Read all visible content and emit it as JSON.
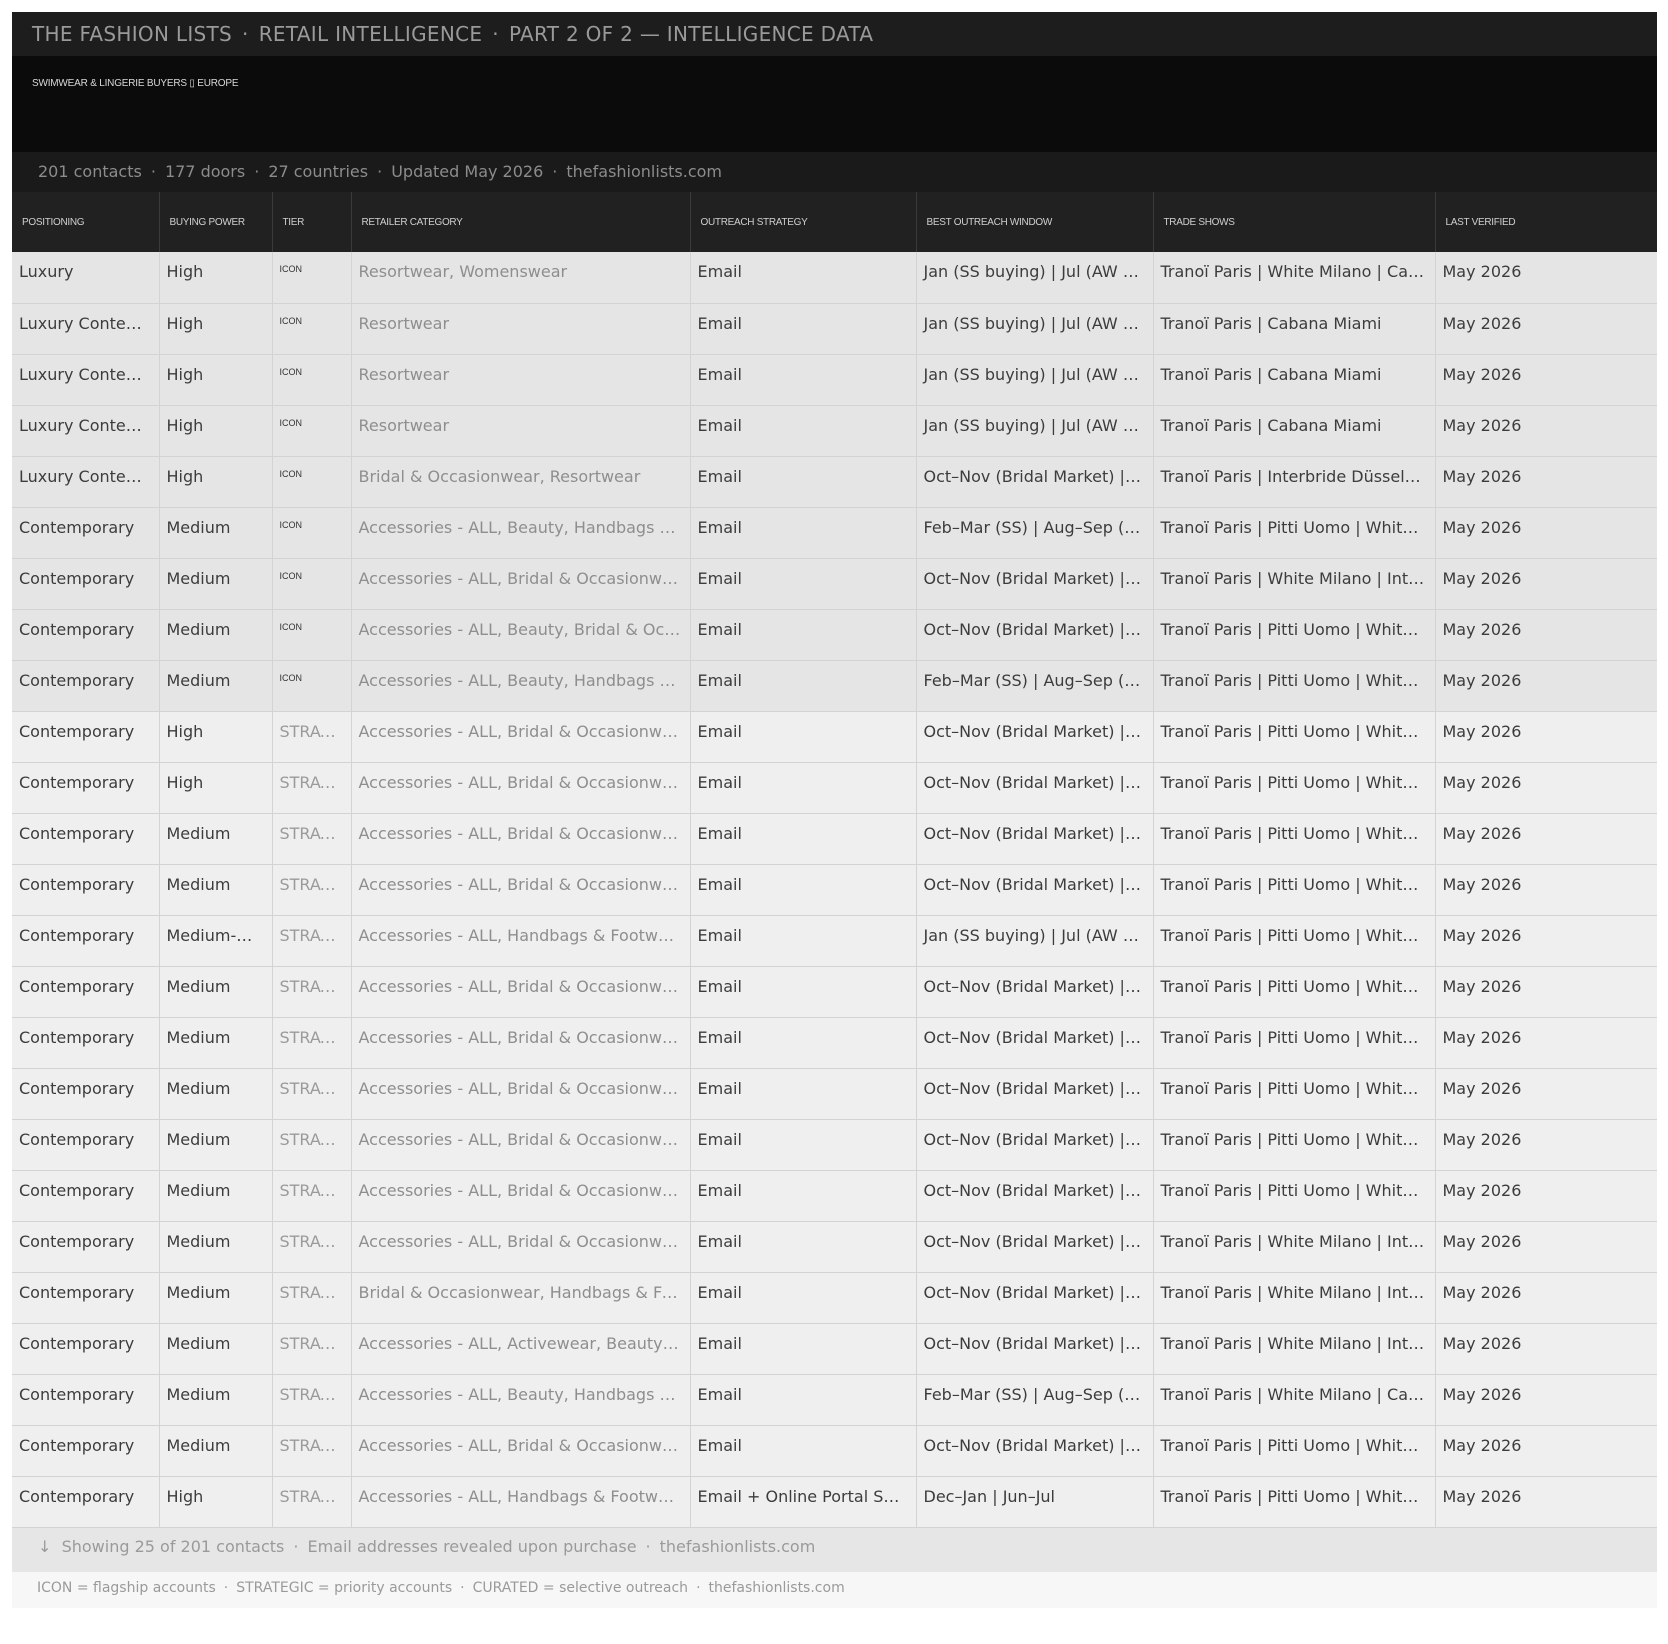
{
  "header": {
    "brand": "THE FASHION LISTS",
    "section": "RETAIL INTELLIGENCE",
    "part": "PART 2 OF 2 — INTELLIGENCE DATA",
    "separator": "·"
  },
  "hero": {
    "subtitle": "SWIMWEAR & LINGERIE BUYERS ▯ EUROPE"
  },
  "stats": {
    "contacts": "201 contacts",
    "doors": "177 doors",
    "countries": "27 countries",
    "updated": "Updated May 2026",
    "site": "thefashionlists.com"
  },
  "table": {
    "columns": [
      "POSITIONING",
      "BUYING POWER",
      "TIER",
      "RETAILER CATEGORY",
      "OUTREACH STRATEGY",
      "BEST OUTREACH WINDOW",
      "TRADE SHOWS",
      "LAST VERIFIED"
    ],
    "rows": [
      {
        "positioning": "Luxury",
        "buying_power": "High",
        "tier": "ICON",
        "category": "Resortwear, Womenswear",
        "outreach": "Email",
        "window": "Jan (SS buying) | Jul (AW buying)",
        "trade_shows": "Tranoï Paris | White Milano | Cabana Miami",
        "verified": "May 2026"
      },
      {
        "positioning": "Luxury Contemporary",
        "buying_power": "High",
        "tier": "ICON",
        "category": "Resortwear",
        "outreach": "Email",
        "window": "Jan (SS buying) | Jul (AW buying)",
        "trade_shows": "Tranoï Paris | Cabana Miami",
        "verified": "May 2026"
      },
      {
        "positioning": "Luxury Contemporary",
        "buying_power": "High",
        "tier": "ICON",
        "category": "Resortwear",
        "outreach": "Email",
        "window": "Jan (SS buying) | Jul (AW buying)",
        "trade_shows": "Tranoï Paris | Cabana Miami",
        "verified": "May 2026"
      },
      {
        "positioning": "Luxury Contemporary",
        "buying_power": "High",
        "tier": "ICON",
        "category": "Resortwear",
        "outreach": "Email",
        "window": "Jan (SS buying) | Jul (AW buying)",
        "trade_shows": "Tranoï Paris | Cabana Miami",
        "verified": "May 2026"
      },
      {
        "positioning": "Luxury Contemporary",
        "buying_power": "High",
        "tier": "ICON",
        "category": "Bridal & Occasionwear, Resortwear",
        "outreach": "Email",
        "window": "Oct–Nov (Bridal Market) | Apr",
        "trade_shows": "Tranoï Paris | Interbride Düsseldorf",
        "verified": "May 2026"
      },
      {
        "positioning": "Contemporary",
        "buying_power": "Medium",
        "tier": "ICON",
        "category": "Accessories - ALL, Beauty, Handbags & Footwear",
        "outreach": "Email",
        "window": "Feb–Mar (SS) | Aug–Sep (AW)",
        "trade_shows": "Tranoï Paris | Pitti Uomo | White Milano",
        "verified": "May 2026"
      },
      {
        "positioning": "Contemporary",
        "buying_power": "Medium",
        "tier": "ICON",
        "category": "Accessories - ALL, Bridal & Occasionwear, Resortwear",
        "outreach": "Email",
        "window": "Oct–Nov (Bridal Market) | Apr",
        "trade_shows": "Tranoï Paris | White Milano | Interbride",
        "verified": "May 2026"
      },
      {
        "positioning": "Contemporary",
        "buying_power": "Medium",
        "tier": "ICON",
        "category": "Accessories - ALL, Beauty, Bridal & Occasionwear",
        "outreach": "Email",
        "window": "Oct–Nov (Bridal Market) | Apr",
        "trade_shows": "Tranoï Paris | Pitti Uomo | White Milano",
        "verified": "May 2026"
      },
      {
        "positioning": "Contemporary",
        "buying_power": "Medium",
        "tier": "ICON",
        "category": "Accessories - ALL, Beauty, Handbags & Footwear",
        "outreach": "Email",
        "window": "Feb–Mar (SS) | Aug–Sep (AW)",
        "trade_shows": "Tranoï Paris | Pitti Uomo | White Milano",
        "verified": "May 2026"
      },
      {
        "positioning": "Contemporary",
        "buying_power": "High",
        "tier": "STRATEGIC",
        "category": "Accessories - ALL, Bridal & Occasionwear, Resortwear",
        "outreach": "Email",
        "window": "Oct–Nov (Bridal Market) | Apr",
        "trade_shows": "Tranoï Paris | Pitti Uomo | White Milano",
        "verified": "May 2026"
      },
      {
        "positioning": "Contemporary",
        "buying_power": "High",
        "tier": "STRATEGIC",
        "category": "Accessories - ALL, Bridal & Occasionwear, Resortwear",
        "outreach": "Email",
        "window": "Oct–Nov (Bridal Market) | Apr",
        "trade_shows": "Tranoï Paris | Pitti Uomo | White Milano",
        "verified": "May 2026"
      },
      {
        "positioning": "Contemporary",
        "buying_power": "Medium",
        "tier": "STRATEGIC",
        "category": "Accessories - ALL, Bridal & Occasionwear, Resortwear",
        "outreach": "Email",
        "window": "Oct–Nov (Bridal Market) | Apr",
        "trade_shows": "Tranoï Paris | Pitti Uomo | White Milano",
        "verified": "May 2026"
      },
      {
        "positioning": "Contemporary",
        "buying_power": "Medium",
        "tier": "STRATEGIC",
        "category": "Accessories - ALL, Bridal & Occasionwear, Resortwear",
        "outreach": "Email",
        "window": "Oct–Nov (Bridal Market) | Apr",
        "trade_shows": "Tranoï Paris | Pitti Uomo | White Milano",
        "verified": "May 2026"
      },
      {
        "positioning": "Contemporary",
        "buying_power": "Medium-High",
        "tier": "STRATEGIC",
        "category": "Accessories - ALL, Handbags & Footwear, Resortwear",
        "outreach": "Email",
        "window": "Jan (SS buying) | Jul (AW buying)",
        "trade_shows": "Tranoï Paris | Pitti Uomo | White Milano",
        "verified": "May 2026"
      },
      {
        "positioning": "Contemporary",
        "buying_power": "Medium",
        "tier": "STRATEGIC",
        "category": "Accessories - ALL, Bridal & Occasionwear, Resortwear",
        "outreach": "Email",
        "window": "Oct–Nov (Bridal Market) | Apr",
        "trade_shows": "Tranoï Paris | Pitti Uomo | White Milano",
        "verified": "May 2026"
      },
      {
        "positioning": "Contemporary",
        "buying_power": "Medium",
        "tier": "STRATEGIC",
        "category": "Accessories - ALL, Bridal & Occasionwear, Resortwear",
        "outreach": "Email",
        "window": "Oct–Nov (Bridal Market) | Apr",
        "trade_shows": "Tranoï Paris | Pitti Uomo | White Milano",
        "verified": "May 2026"
      },
      {
        "positioning": "Contemporary",
        "buying_power": "Medium",
        "tier": "STRATEGIC",
        "category": "Accessories - ALL, Bridal & Occasionwear, Resortwear",
        "outreach": "Email",
        "window": "Oct–Nov (Bridal Market) | Apr",
        "trade_shows": "Tranoï Paris | Pitti Uomo | White Milano",
        "verified": "May 2026"
      },
      {
        "positioning": "Contemporary",
        "buying_power": "Medium",
        "tier": "STRATEGIC",
        "category": "Accessories - ALL, Bridal & Occasionwear, Resortwear",
        "outreach": "Email",
        "window": "Oct–Nov (Bridal Market) | Apr",
        "trade_shows": "Tranoï Paris | Pitti Uomo | White Milano",
        "verified": "May 2026"
      },
      {
        "positioning": "Contemporary",
        "buying_power": "Medium",
        "tier": "STRATEGIC",
        "category": "Accessories - ALL, Bridal & Occasionwear, Resortwear",
        "outreach": "Email",
        "window": "Oct–Nov (Bridal Market) | Apr",
        "trade_shows": "Tranoï Paris | Pitti Uomo | White Milano",
        "verified": "May 2026"
      },
      {
        "positioning": "Contemporary",
        "buying_power": "Medium",
        "tier": "STRATEGIC",
        "category": "Accessories - ALL, Bridal & Occasionwear, Resortwear",
        "outreach": "Email",
        "window": "Oct–Nov (Bridal Market) | Apr",
        "trade_shows": "Tranoï Paris | White Milano | Interbride",
        "verified": "May 2026"
      },
      {
        "positioning": "Contemporary",
        "buying_power": "Medium",
        "tier": "STRATEGIC",
        "category": "Bridal & Occasionwear, Handbags & Footwear",
        "outreach": "Email",
        "window": "Oct–Nov (Bridal Market) | Apr",
        "trade_shows": "Tranoï Paris | White Milano | Interbride",
        "verified": "May 2026"
      },
      {
        "positioning": "Contemporary",
        "buying_power": "Medium",
        "tier": "STRATEGIC",
        "category": "Accessories - ALL, Activewear, Beauty, Bridal",
        "outreach": "Email",
        "window": "Oct–Nov (Bridal Market) | Apr",
        "trade_shows": "Tranoï Paris | White Milano | Interbride",
        "verified": "May 2026"
      },
      {
        "positioning": "Contemporary",
        "buying_power": "Medium",
        "tier": "STRATEGIC",
        "category": "Accessories - ALL, Beauty, Handbags & Footwear",
        "outreach": "Email",
        "window": "Feb–Mar (SS) | Aug–Sep (AW)",
        "trade_shows": "Tranoï Paris | White Milano | Cabana Miami",
        "verified": "May 2026"
      },
      {
        "positioning": "Contemporary",
        "buying_power": "Medium",
        "tier": "STRATEGIC",
        "category": "Accessories - ALL, Bridal & Occasionwear, Resortwear",
        "outreach": "Email",
        "window": "Oct–Nov (Bridal Market) | Apr",
        "trade_shows": "Tranoï Paris | Pitti Uomo | White Milano",
        "verified": "May 2026"
      },
      {
        "positioning": "Contemporary",
        "buying_power": "High",
        "tier": "STRATEGIC",
        "category": "Accessories - ALL, Handbags & Footwear, Resortwear",
        "outreach": "Email + Online Portal Submission",
        "window": "Dec–Jan | Jun–Jul",
        "trade_shows": "Tranoï Paris | Pitti Uomo | White Milano",
        "verified": "May 2026"
      }
    ]
  },
  "footer": {
    "arrow": "↓",
    "showing": "Showing 25 of 201 contacts",
    "reveal": "Email addresses revealed upon purchase",
    "site": "thefashionlists.com"
  },
  "legend": {
    "icon": "ICON = flagship accounts",
    "strategic": "STRATEGIC = priority accounts",
    "curated": "CURATED = selective outreach",
    "site": "thefashionlists.com"
  }
}
